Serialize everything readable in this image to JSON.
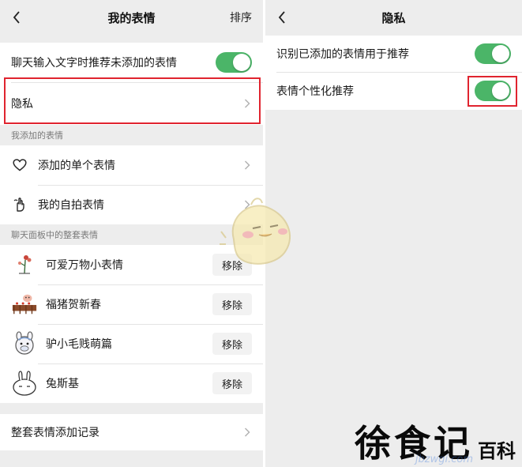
{
  "left_panel": {
    "title": "我的表情",
    "action": "排序",
    "recommend_row": {
      "label": "聊天输入文字时推荐未添加的表情",
      "toggle_on": true
    },
    "privacy_row": {
      "label": "隐私"
    },
    "added_section": {
      "header": "我添加的表情",
      "items": [
        {
          "label": "添加的单个表情",
          "icon": "heart-icon"
        },
        {
          "label": "我的自拍表情",
          "icon": "selfie-hand-icon"
        }
      ]
    },
    "packs_section": {
      "header": "聊天面板中的整套表情",
      "items": [
        {
          "label": "可爱万物小表情",
          "button": "移除",
          "thumb": "flower-sticker-thumb"
        },
        {
          "label": "福猪贺新春",
          "button": "移除",
          "thumb": "pig-sticker-thumb"
        },
        {
          "label": "驴小毛贱萌篇",
          "button": "移除",
          "thumb": "donkey-sticker-thumb"
        },
        {
          "label": "兔斯基",
          "button": "移除",
          "thumb": "rabbit-sticker-thumb"
        }
      ]
    },
    "history_row": {
      "label": "整套表情添加记录"
    }
  },
  "right_panel": {
    "title": "隐私",
    "rows": [
      {
        "label": "识别已添加的表情用于推荐",
        "toggle_on": true
      },
      {
        "label": "表情个性化推荐",
        "toggle_on": true
      }
    ]
  },
  "colors": {
    "toggle_on": "#4bb568",
    "highlight": "#e0242f",
    "background": "#ededed"
  },
  "watermark": {
    "main": "徐食记",
    "sub": "百科",
    "small": "jbzwgi.com"
  }
}
